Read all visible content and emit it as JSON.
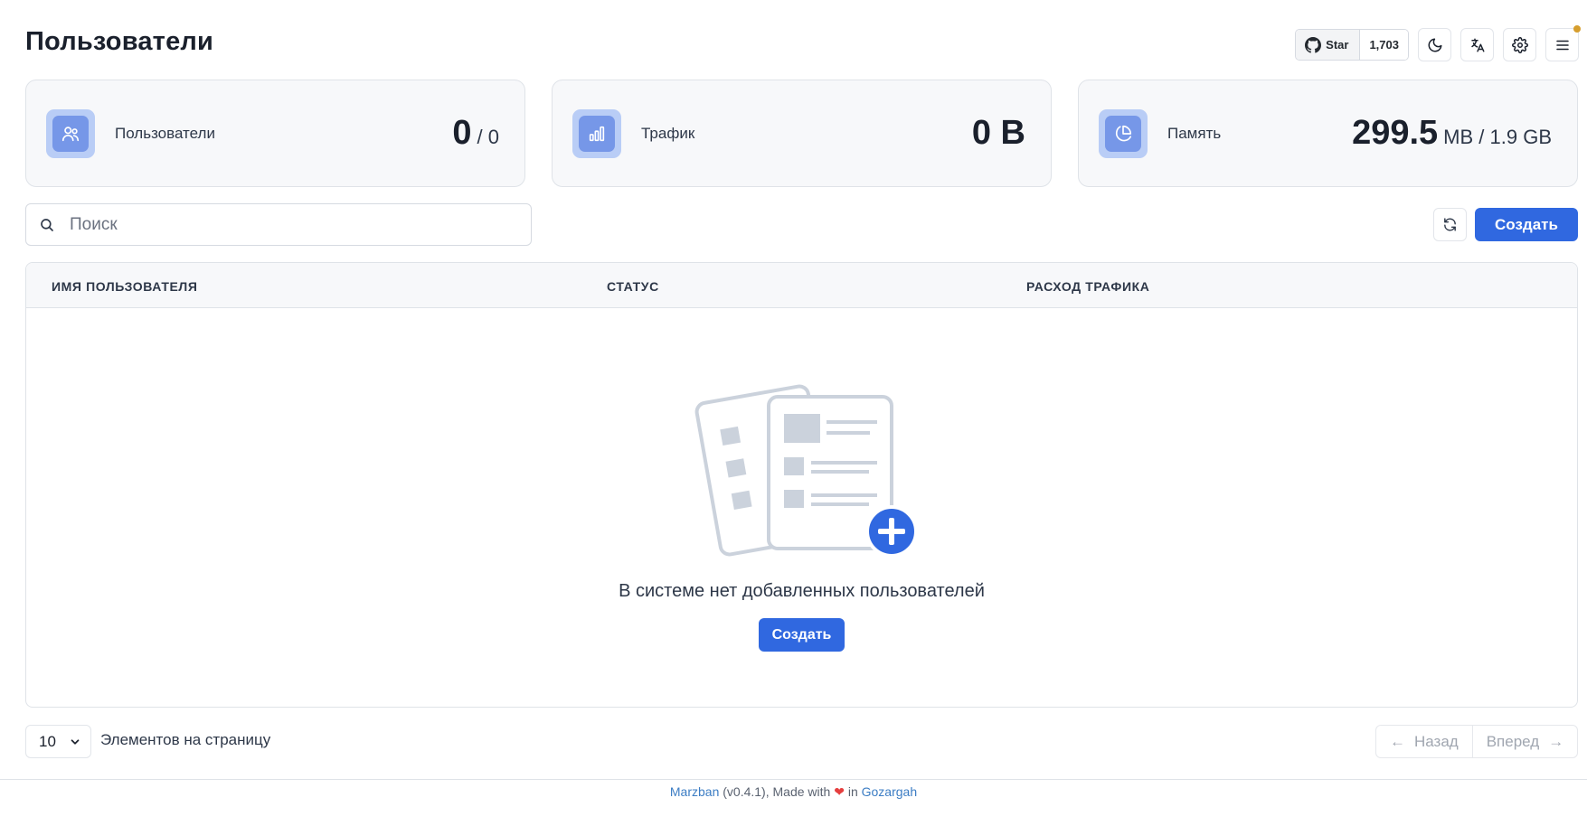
{
  "page": {
    "title": "Пользователи"
  },
  "header": {
    "github_star_label": "Star",
    "github_star_count": "1,703",
    "icons": [
      "github-icon",
      "moon-icon",
      "translate-icon",
      "gear-icon",
      "menu-icon"
    ],
    "notification_color": "#d69e2e"
  },
  "stats": [
    {
      "label": "Пользователи",
      "value": "0",
      "suffix": "/ 0",
      "icon": "users-icon"
    },
    {
      "label": "Трафик",
      "value": "0 B",
      "suffix": "",
      "icon": "bar-chart-icon"
    },
    {
      "label": "Память",
      "value": "299.5",
      "suffix": "MB / 1.9 GB",
      "icon": "pie-chart-icon"
    }
  ],
  "search": {
    "placeholder": "Поиск",
    "value": ""
  },
  "actions": {
    "create_label": "Создать"
  },
  "table": {
    "columns": [
      "ИМЯ ПОЛЬЗОВАТЕЛЯ",
      "СТАТУС",
      "РАСХОД ТРАФИКА"
    ],
    "rows": [],
    "empty_text": "В системе нет добавленных пользователей",
    "empty_create_label": "Создать"
  },
  "pagination": {
    "per_page_value": "10",
    "per_page_label": "Элементов на страницу",
    "prev_label": "Назад",
    "next_label": "Вперед"
  },
  "footer": {
    "brand": "Marzban",
    "version_text": "(v0.4.1), Made with",
    "in_text": "in",
    "location": "Gozargah"
  },
  "colors": {
    "accent": "#3068e0",
    "icon_tile": "#7697e8",
    "icon_tile_bg": "#b9cdf6"
  }
}
